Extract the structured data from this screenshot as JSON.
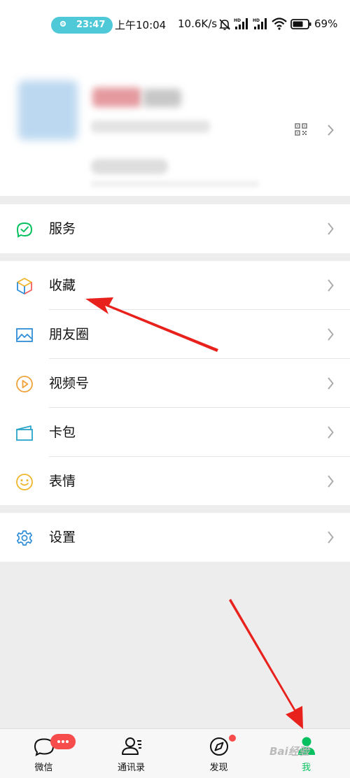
{
  "status_bar": {
    "call_timer": "23:47",
    "time": "上午10:04",
    "net_speed": "10.6K/s",
    "battery": "69%",
    "icons": [
      "mute-icon",
      "signal-hd-1-icon",
      "signal-hd-2-icon",
      "wifi-icon",
      "battery-icon"
    ]
  },
  "profile": {
    "icons": [
      "qr-code-icon",
      "chevron-right-icon"
    ]
  },
  "menu": {
    "services": {
      "label": "服务",
      "icon": "services-icon",
      "color": "#07c160"
    },
    "favorites": {
      "label": "收藏",
      "icon": "cube-icon"
    },
    "moments": {
      "label": "朋友圈",
      "icon": "image-icon",
      "color": "#2f8ed8"
    },
    "channels": {
      "label": "视频号",
      "icon": "play-circle-icon",
      "color": "#f0a33a"
    },
    "cards": {
      "label": "卡包",
      "icon": "wallet-icon",
      "color": "#2aa4c8"
    },
    "stickers": {
      "label": "表情",
      "icon": "smiley-icon",
      "color": "#f0b52a"
    },
    "settings": {
      "label": "设置",
      "icon": "gear-icon",
      "color": "#2f8ed8"
    }
  },
  "tabbar": {
    "chats": {
      "label": "微信",
      "icon": "chat-bubble-icon",
      "badge": "more"
    },
    "contacts": {
      "label": "通讯录",
      "icon": "contacts-icon"
    },
    "discover": {
      "label": "发现",
      "icon": "compass-icon",
      "badge": "dot"
    },
    "me": {
      "label": "我",
      "icon": "person-icon",
      "active": true,
      "color": "#07c160"
    }
  },
  "annotations": {
    "arrow_color": "#e8211c"
  }
}
